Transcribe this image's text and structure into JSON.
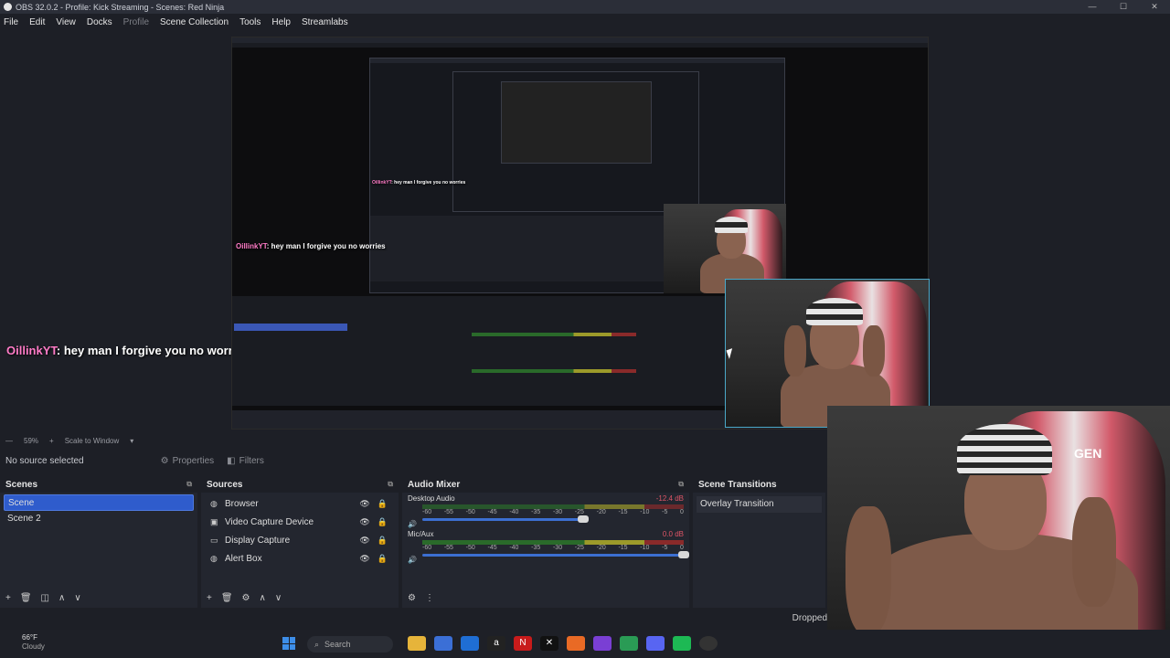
{
  "window": {
    "title": "OBS 32.0.2 - Profile: Kick Streaming - Scenes: Red Ninja",
    "controls": [
      "—",
      "☐",
      "✕"
    ]
  },
  "menu": [
    "File",
    "Edit",
    "View",
    "Docks",
    "Profile",
    "Scene Collection",
    "Tools",
    "Help",
    "Streamlabs"
  ],
  "preview": {
    "chat_user": "OillinkYT",
    "chat_message": ": hey man I forgive you no worries",
    "nested_chat_user": "OillinkYT",
    "nested_chat_message": ": hey man I forgive you no worries",
    "nested_chat_user_2": "OillinkYT",
    "nested_chat_message_2": ": hey man I forgive you no worries",
    "cam_label": "GEN"
  },
  "scene_info": {
    "zoom": "59%",
    "scale_mode": "Scale to Window"
  },
  "toolbar": {
    "no_source": "No source selected",
    "properties": "Properties",
    "filters": "Filters"
  },
  "scenes": {
    "title": "Scenes",
    "items": [
      "Scene",
      "Scene 2"
    ],
    "selected": 0
  },
  "sources": {
    "title": "Sources",
    "items": [
      {
        "label": "Browser",
        "icon": "globe-icon"
      },
      {
        "label": "Video Capture Device",
        "icon": "camera-icon"
      },
      {
        "label": "Display Capture",
        "icon": "monitor-icon"
      },
      {
        "label": "Alert Box",
        "icon": "globe-icon"
      }
    ]
  },
  "audio_mixer": {
    "title": "Audio Mixer",
    "tracks": [
      {
        "name": "Desktop Audio",
        "db": "-12.4 dB"
      },
      {
        "name": "Mic/Aux",
        "db": "0.0 dB"
      }
    ],
    "scale": [
      "-60",
      "-55",
      "-50",
      "-45",
      "-40",
      "-35",
      "-30",
      "-25",
      "-20",
      "-15",
      "-10",
      "-5",
      "0"
    ]
  },
  "scene_transitions": {
    "title": "Scene Transitions",
    "current": "Overlay Transition"
  },
  "status": {
    "dropped": "Dropped"
  },
  "taskbar": {
    "temp": "66°F",
    "condition": "Cloudy",
    "search_placeholder": "Search"
  },
  "colors": {
    "accent": "#2f5ccc",
    "chat_user": "#ff7bc7",
    "chair": "#d25a6a"
  }
}
